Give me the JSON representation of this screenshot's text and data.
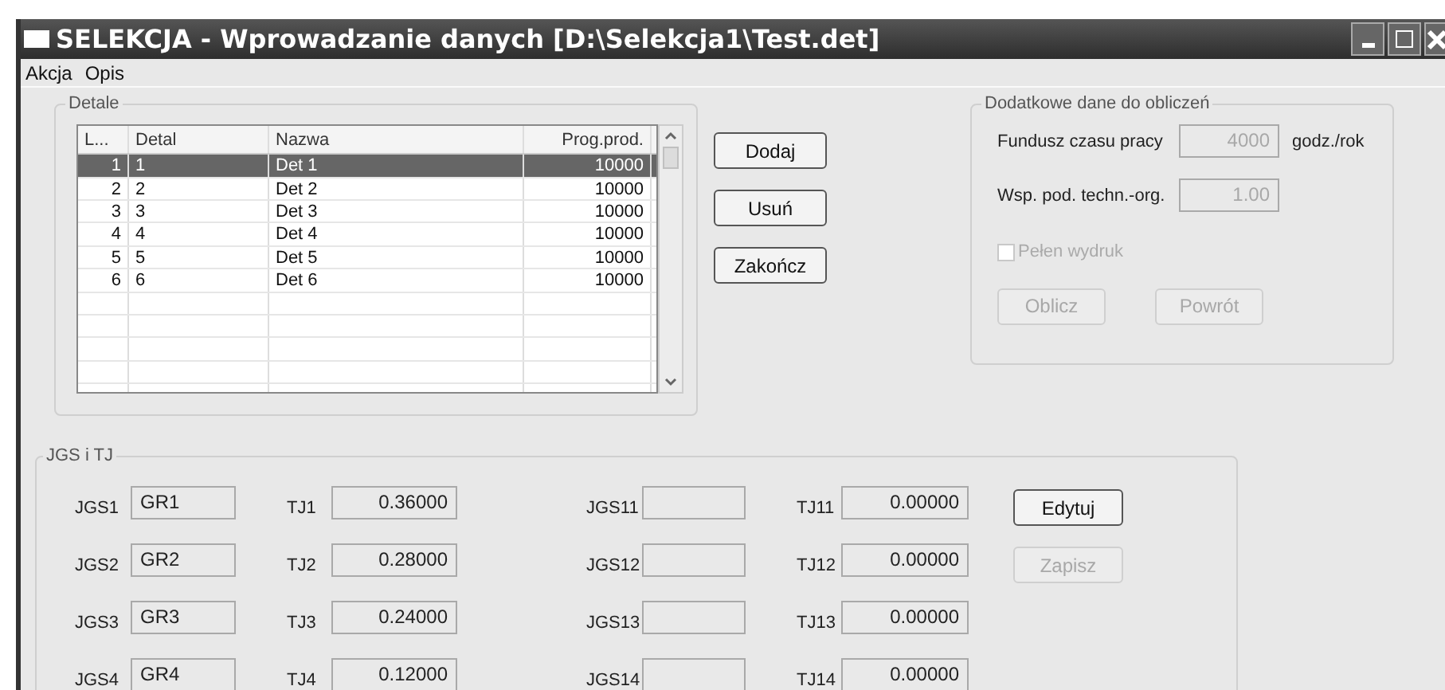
{
  "window": {
    "title": "SELEKCJA - Wprowadzanie danych [D:\\Selekcja1\\Test.det]"
  },
  "menu": [
    {
      "label": "Akcja"
    },
    {
      "label": "Opis"
    }
  ],
  "details": {
    "title": "Detale",
    "columns": [
      "L...",
      "Detal",
      "Nazwa",
      "Prog.prod."
    ],
    "rows": [
      {
        "cells": [
          "1",
          "1",
          "Det 1",
          "10000"
        ],
        "selected": true
      },
      {
        "cells": [
          "2",
          "2",
          "Det 2",
          "10000"
        ],
        "selected": false
      },
      {
        "cells": [
          "3",
          "3",
          "Det 3",
          "10000"
        ],
        "selected": false
      },
      {
        "cells": [
          "4",
          "4",
          "Det 4",
          "10000"
        ],
        "selected": false
      },
      {
        "cells": [
          "5",
          "5",
          "Det 5",
          "10000"
        ],
        "selected": false
      },
      {
        "cells": [
          "6",
          "6",
          "Det 6",
          "10000"
        ],
        "selected": false
      }
    ],
    "buttons": [
      {
        "label": "Dodaj"
      },
      {
        "label": "Usuń"
      },
      {
        "label": "Zakończ"
      }
    ]
  },
  "extra": {
    "title": "Dodatkowe dane do obliczeń",
    "fields": [
      {
        "label": "Fundusz czasu pracy",
        "value": "4000",
        "unit": "godz./rok",
        "disabled": true
      },
      {
        "label": "Wsp. pod. techn.-org.",
        "value": "1.00",
        "disabled": true
      }
    ],
    "checkbox": {
      "label": "Pełen wydruk",
      "checked": false,
      "disabled": true
    },
    "buttons": [
      {
        "label": "Oblicz",
        "disabled": true
      },
      {
        "label": "Powrót",
        "disabled": true
      }
    ]
  },
  "jgs": {
    "title": "JGS i TJ",
    "rows": [
      {
        "jgs_label": "JGS1",
        "jgs_value": "GR1",
        "tj_label": "TJ1",
        "tj_value": "0.36000",
        "jgs2_label": "JGS11",
        "tj2_label": "TJ11",
        "tj2_value": "0.00000"
      },
      {
        "jgs_label": "JGS2",
        "jgs_value": "GR2",
        "tj_label": "TJ2",
        "tj_value": "0.28000",
        "jgs2_label": "JGS12",
        "tj2_label": "TJ12",
        "tj2_value": "0.00000"
      },
      {
        "jgs_label": "JGS3",
        "jgs_value": "GR3",
        "tj_label": "TJ3",
        "tj_value": "0.24000",
        "jgs2_label": "JGS13",
        "tj2_label": "TJ13",
        "tj2_value": "0.00000"
      },
      {
        "jgs_label": "JGS4",
        "jgs_value": "GR4",
        "tj_label": "TJ4",
        "tj_value": "0.12000",
        "jgs2_label": "JGS14",
        "tj2_label": "TJ14",
        "tj2_value": "0.00000"
      }
    ],
    "buttons": [
      {
        "label": "Edytuj",
        "disabled": false
      },
      {
        "label": "Zapisz",
        "disabled": true
      }
    ]
  }
}
